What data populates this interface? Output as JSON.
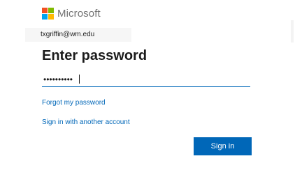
{
  "brand": {
    "name": "Microsoft",
    "logo_colors": [
      "#f25022",
      "#7fba00",
      "#00a4ef",
      "#ffb900"
    ]
  },
  "identity": {
    "email": "txgriffin@wm.edu"
  },
  "heading": "Enter password",
  "password_field": {
    "masked_value": "••••••••••",
    "type": "password"
  },
  "links": {
    "forgot_password": "Forgot my password",
    "another_account": "Sign in with another account"
  },
  "buttons": {
    "sign_in": "Sign in"
  },
  "colors": {
    "accent": "#0067b8",
    "text": "#1b1b1b",
    "logo_text": "#737373"
  }
}
